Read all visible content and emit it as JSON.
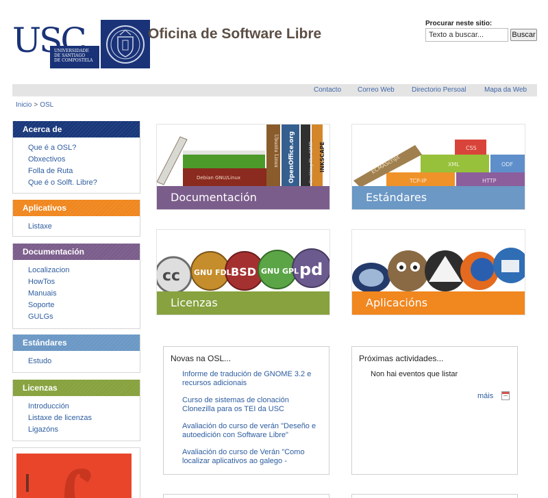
{
  "header": {
    "logo_letters": "USC",
    "logo_university": [
      "UNIVERSIDADE",
      "DE SANTIAGO",
      "DE COMPOSTELA"
    ],
    "site_title": "Oficina de Software Libre",
    "search": {
      "label": "Procurar neste sitio:",
      "value": "Texto a buscar...",
      "button": "Buscar"
    }
  },
  "topnav": [
    "Contacto",
    "Correo Web",
    "Directorio Persoal",
    "Mapa da Web"
  ],
  "breadcrumb": {
    "home": "Inicio",
    "separator": ">",
    "current": "OSL"
  },
  "sidebar": {
    "acerca": {
      "title": "Acerca de",
      "items": [
        "Que é a OSL?",
        "Obxectivos",
        "Folla de Ruta",
        "Que é o Solft. Libre?"
      ]
    },
    "aplicativos": {
      "title": "Aplicativos",
      "items": [
        "Listaxe"
      ]
    },
    "documentacion": {
      "title": "Documentación",
      "items": [
        "Localizacion",
        "HowTos",
        "Manuais",
        "Soporte",
        "GULGs"
      ]
    },
    "estandares": {
      "title": "Estándares",
      "items": [
        "Estudo"
      ]
    },
    "licenzas": {
      "title": "Licenzas",
      "items": [
        "Introducción",
        "Listaxe de licenzas",
        "Ligazóns"
      ]
    }
  },
  "tiles": {
    "documentacion": {
      "label": "Documentación",
      "books": [
        "Debian GNU/Linux",
        "Ubuntu Linux",
        "OpenOffice.org",
        "Grokking The GIMP",
        "INKSCAPE"
      ]
    },
    "estandares": {
      "label": "Estándares",
      "blocks": [
        "ECMAScript",
        "CSS",
        "XML",
        "ODF",
        "TCP-IP",
        "HTTP"
      ]
    },
    "licenzas": {
      "label": "Licenzas",
      "badges": [
        "cc",
        "GNU FDL",
        "BSD",
        "GNU GPL",
        "pd"
      ]
    },
    "aplicacions": {
      "label": "Aplicacións"
    }
  },
  "news": {
    "title": "Novas na OSL...",
    "items": [
      "Informe de tradución de GNOME 3.2 e recursos adicionais",
      "Curso de sistemas de clonación Clonezilla para os TEI da USC",
      "Avaliación do curso de verán \"Deseño e autoedición con Software Libre\"",
      "Avaliación do curso de Verán \"Como localizar aplicativos ao galego -"
    ]
  },
  "events": {
    "title": "Próximas actividades...",
    "empty": "Non hai eventos que listar",
    "more": "máis"
  },
  "colors": {
    "navy": "#19377a",
    "orange": "#f0871f",
    "purple": "#7b5d8b",
    "blue": "#6b98c5",
    "green": "#87a23e",
    "link": "#2d5c9f"
  }
}
